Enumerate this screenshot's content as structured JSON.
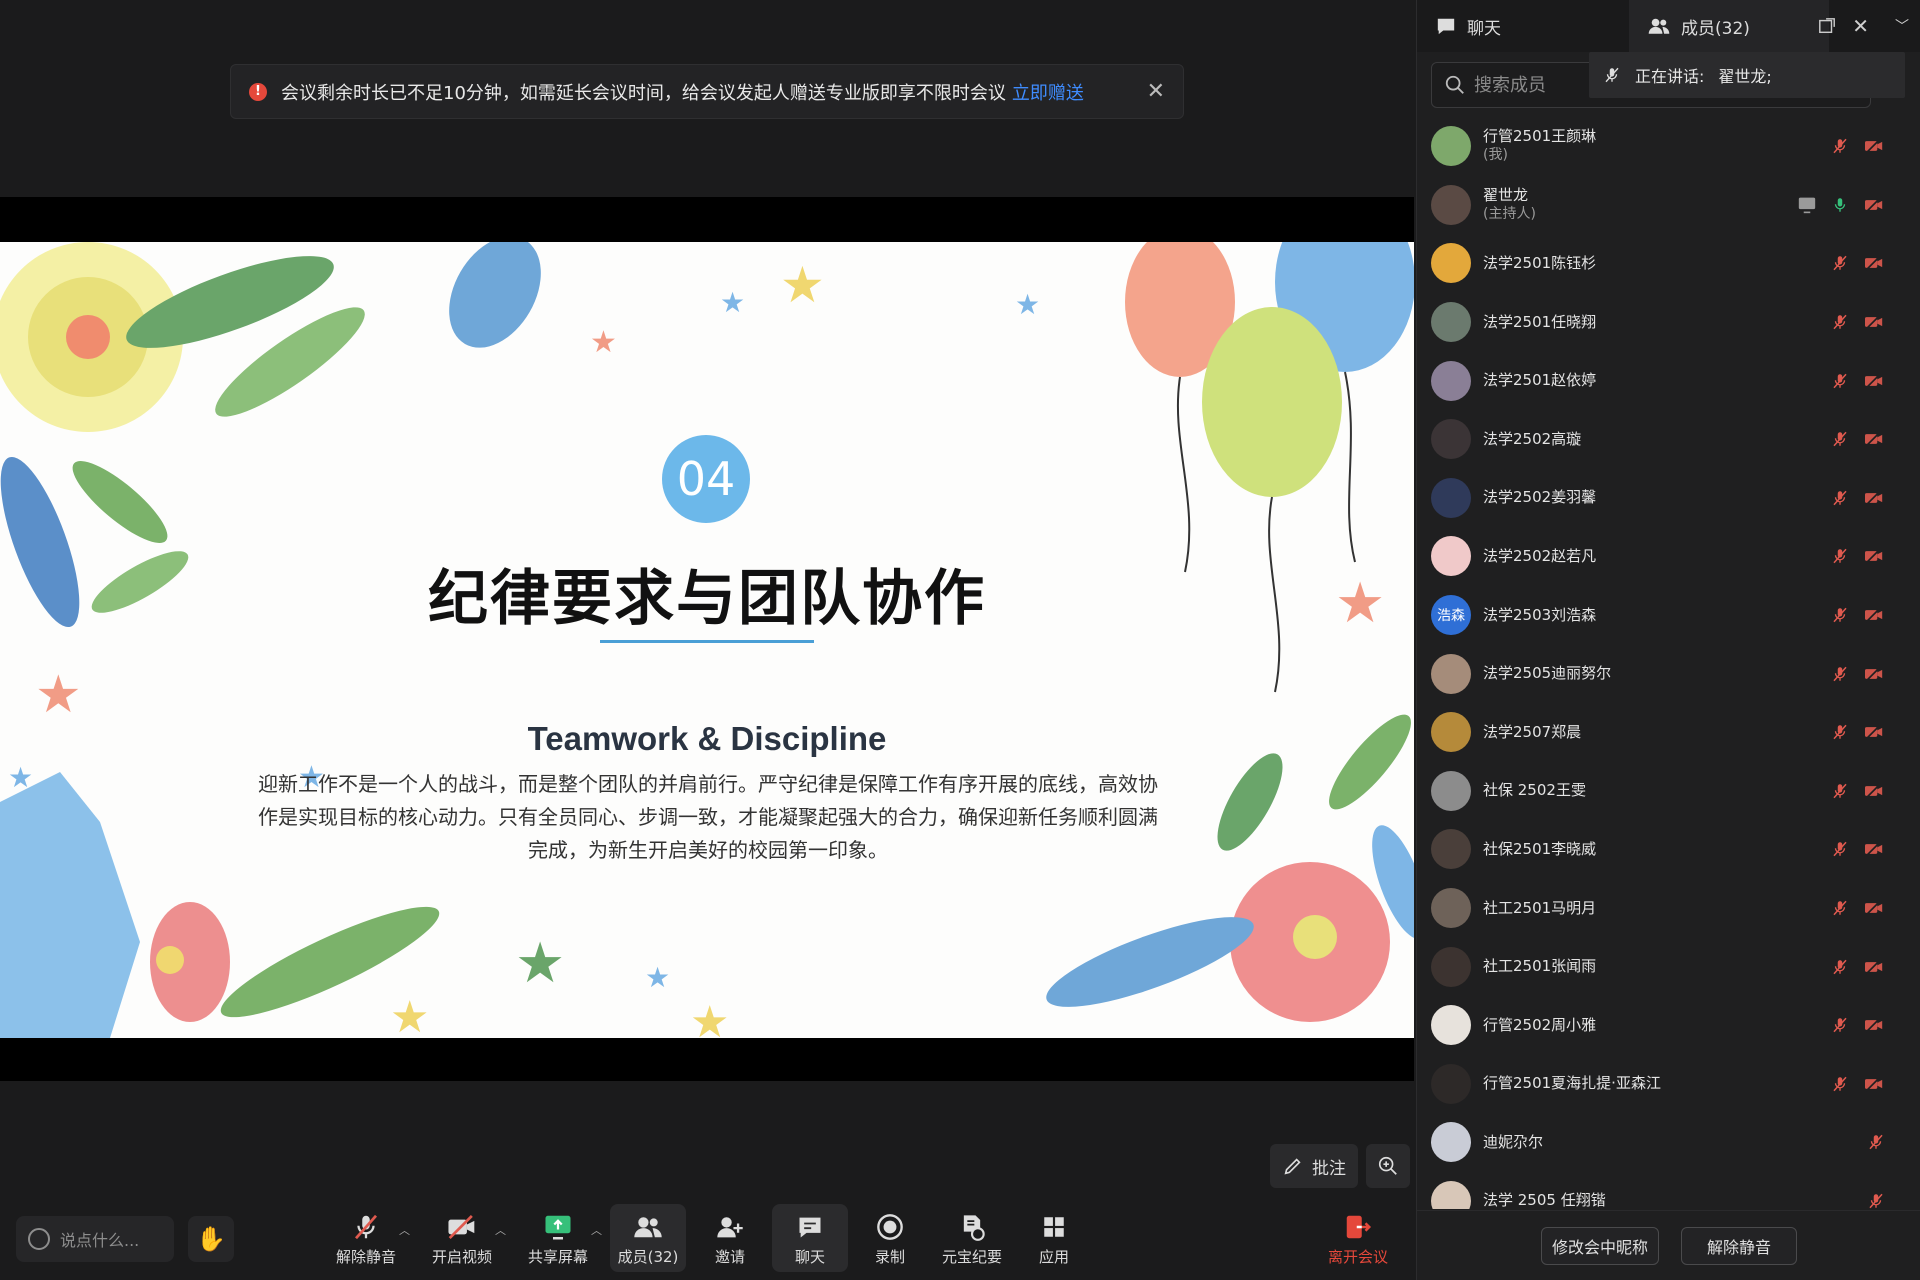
{
  "notice": {
    "text": "会议剩余时长已不足10分钟，如需延长会议时间，给会议发起人赠送专业版即享不限时会议",
    "link": "立即赠送"
  },
  "slide": {
    "number": "04",
    "title": "纪律要求与团队协作",
    "subtitle": "Teamwork & Discipline",
    "body": "迎新工作不是一个人的战斗，而是整个团队的并肩前行。严守纪律是保障工作有序开展的底线，高效协作是实现目标的核心动力。只有全员同心、步调一致，才能凝聚起强大的合力，确保迎新任务顺利圆满完成，为新生开启美好的校园第一印象。"
  },
  "annotate": {
    "label": "批注"
  },
  "toolbar": {
    "say_placeholder": "说点什么...",
    "items": [
      {
        "label": "解除静音"
      },
      {
        "label": "开启视频"
      },
      {
        "label": "共享屏幕"
      },
      {
        "label": "成员(32)"
      },
      {
        "label": "邀请"
      },
      {
        "label": "聊天"
      },
      {
        "label": "录制"
      },
      {
        "label": "元宝纪要"
      },
      {
        "label": "应用"
      }
    ],
    "leave": "离开会议"
  },
  "panel": {
    "tab_chat": "聊天",
    "tab_members": "成员(32)",
    "search_placeholder": "搜索成员",
    "speaking_label": "正在讲话:",
    "speaking_name": "翟世龙;",
    "members": [
      {
        "name": "行管2501王颜琳",
        "role": "(我)",
        "avatar_color": "#7ea86b"
      },
      {
        "name": "翟世龙",
        "role": "(主持人)",
        "avatar_color": "#5a4a44"
      },
      {
        "name": "法学2501陈钰杉",
        "role": "",
        "avatar_color": "#e3a83b"
      },
      {
        "name": "法学2501任晓翔",
        "role": "",
        "avatar_color": "#6b7a6e"
      },
      {
        "name": "法学2501赵依婷",
        "role": "",
        "avatar_color": "#8a7f96"
      },
      {
        "name": "法学2502高璇",
        "role": "",
        "avatar_color": "#3b3436"
      },
      {
        "name": "法学2502姜羽馨",
        "role": "",
        "avatar_color": "#2f3a5a"
      },
      {
        "name": "法学2502赵若凡",
        "role": "",
        "avatar_color": "#f0c9c9"
      },
      {
        "name": "法学2503刘浩森",
        "role": "",
        "avatar_color": "#2f6fd6",
        "avatar_text": "浩森"
      },
      {
        "name": "法学2505迪丽努尔",
        "role": "",
        "avatar_color": "#a58c7a"
      },
      {
        "name": "法学2507郑晨",
        "role": "",
        "avatar_color": "#b58a3a"
      },
      {
        "name": "社保 2502王雯",
        "role": "",
        "avatar_color": "#8c8c8c"
      },
      {
        "name": "社保2501李晓威",
        "role": "",
        "avatar_color": "#4a3f3a"
      },
      {
        "name": "社工2501马明月",
        "role": "",
        "avatar_color": "#6e6259"
      },
      {
        "name": "社工2501张闻雨",
        "role": "",
        "avatar_color": "#3c3330"
      },
      {
        "name": "行管2502周小雅",
        "role": "",
        "avatar_color": "#e7e2dc"
      },
      {
        "name": "行管2501夏海扎提·亚森江",
        "role": "",
        "avatar_color": "#2d2928"
      },
      {
        "name": "迪妮尕尔",
        "role": "",
        "avatar_color": "#c9ccd6"
      },
      {
        "name": "法学 2505 任翔锴",
        "role": "",
        "avatar_color": "#d8c7b8"
      }
    ],
    "btn_rename": "修改会中昵称",
    "btn_unmute": "解除静音"
  },
  "colors": {
    "accent_blue": "#3f8cff",
    "danger_red": "#e5483b",
    "slide_circle": "#6cb8ea",
    "mic_muted": "#e05a4f",
    "mic_active": "#36c07a"
  }
}
